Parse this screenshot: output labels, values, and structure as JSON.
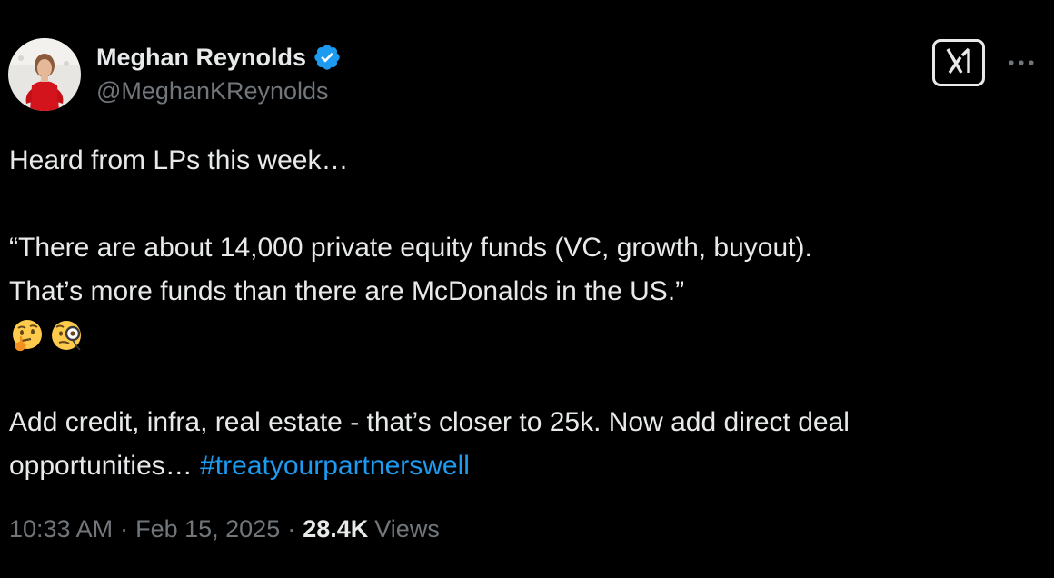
{
  "author": {
    "display_name": "Meghan Reynolds",
    "handle": "@MeghanKReynolds",
    "verified": true,
    "verified_color": "#1d9bf0"
  },
  "tweet": {
    "line1": "Heard from LPs this week…",
    "line2": "“There are about 14,000 private equity funds (VC, growth, buyout).",
    "line3": "That’s more funds than there are McDonalds in the US.”",
    "emojis": [
      "thinking-face",
      "face-with-monocle"
    ],
    "line4": "Add credit, infra, real estate - that’s closer to 25k. Now add direct deal",
    "line5_text": "opportunities… ",
    "hashtag": "#treatyourpartnerswell"
  },
  "meta": {
    "time": "10:33 AM",
    "separator": "·",
    "date": "Feb 15, 2025",
    "views_count": "28.4K",
    "views_label": "Views"
  },
  "colors": {
    "background": "#000000",
    "text": "#e7e9ea",
    "secondary": "#71767b",
    "link": "#1d9bf0"
  },
  "icons": {
    "grok": "grok-icon",
    "more": "more-icon"
  }
}
